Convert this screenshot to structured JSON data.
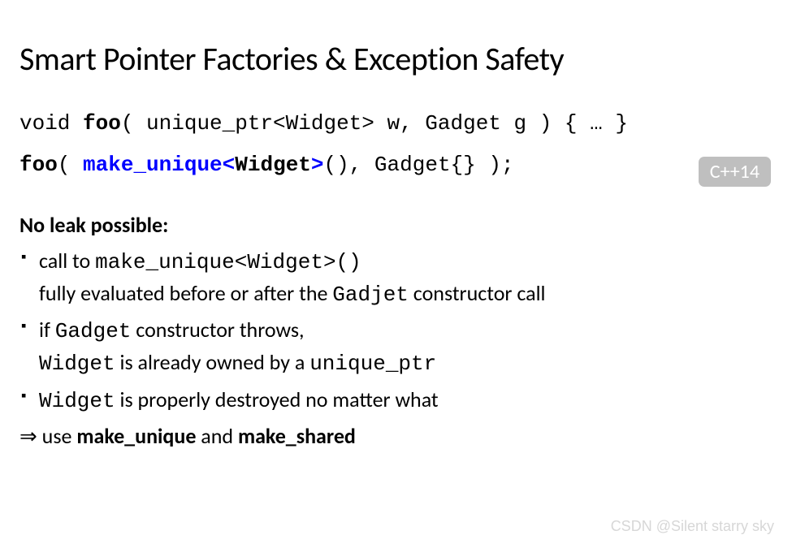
{
  "title": "Smart Pointer Factories & Exception Safety",
  "code": {
    "line1_prefix": "void ",
    "line1_func": "foo",
    "line1_rest": "( unique_ptr<Widget> w, Gadget g ) { … }",
    "line2_func": "foo",
    "line2_open": "( ",
    "line2_make": "make_unique",
    "line2_lt": "<",
    "line2_type": "Widget",
    "line2_gt": ">",
    "line2_rest": "(), Gadget{} );"
  },
  "badge": "C++14",
  "section_title": "No leak possible:",
  "bullets": [
    {
      "parts": [
        {
          "text": "call to ",
          "mono": false
        },
        {
          "text": "make_unique<Widget>()",
          "mono": true
        }
      ],
      "line2": [
        {
          "text": "fully evaluated before or after the ",
          "mono": false
        },
        {
          "text": "Gadjet",
          "mono": true
        },
        {
          "text": " constructor call",
          "mono": false
        }
      ]
    },
    {
      "parts": [
        {
          "text": "if ",
          "mono": false
        },
        {
          "text": "Gadget",
          "mono": true
        },
        {
          "text": " constructor throws,",
          "mono": false
        }
      ],
      "line2": [
        {
          "text": "Widget",
          "mono": true
        },
        {
          "text": " is already owned by a ",
          "mono": false
        },
        {
          "text": "unique_ptr",
          "mono": true
        }
      ]
    },
    {
      "parts": [
        {
          "text": "Widget",
          "mono": true
        },
        {
          "text": " is properly destroyed no matter what",
          "mono": false
        }
      ]
    }
  ],
  "conclusion": {
    "arrow": "⇒ ",
    "pre": "use ",
    "b1": "make_unique",
    "mid": " and ",
    "b2": "make_shared"
  },
  "watermark": "CSDN @Silent starry sky"
}
